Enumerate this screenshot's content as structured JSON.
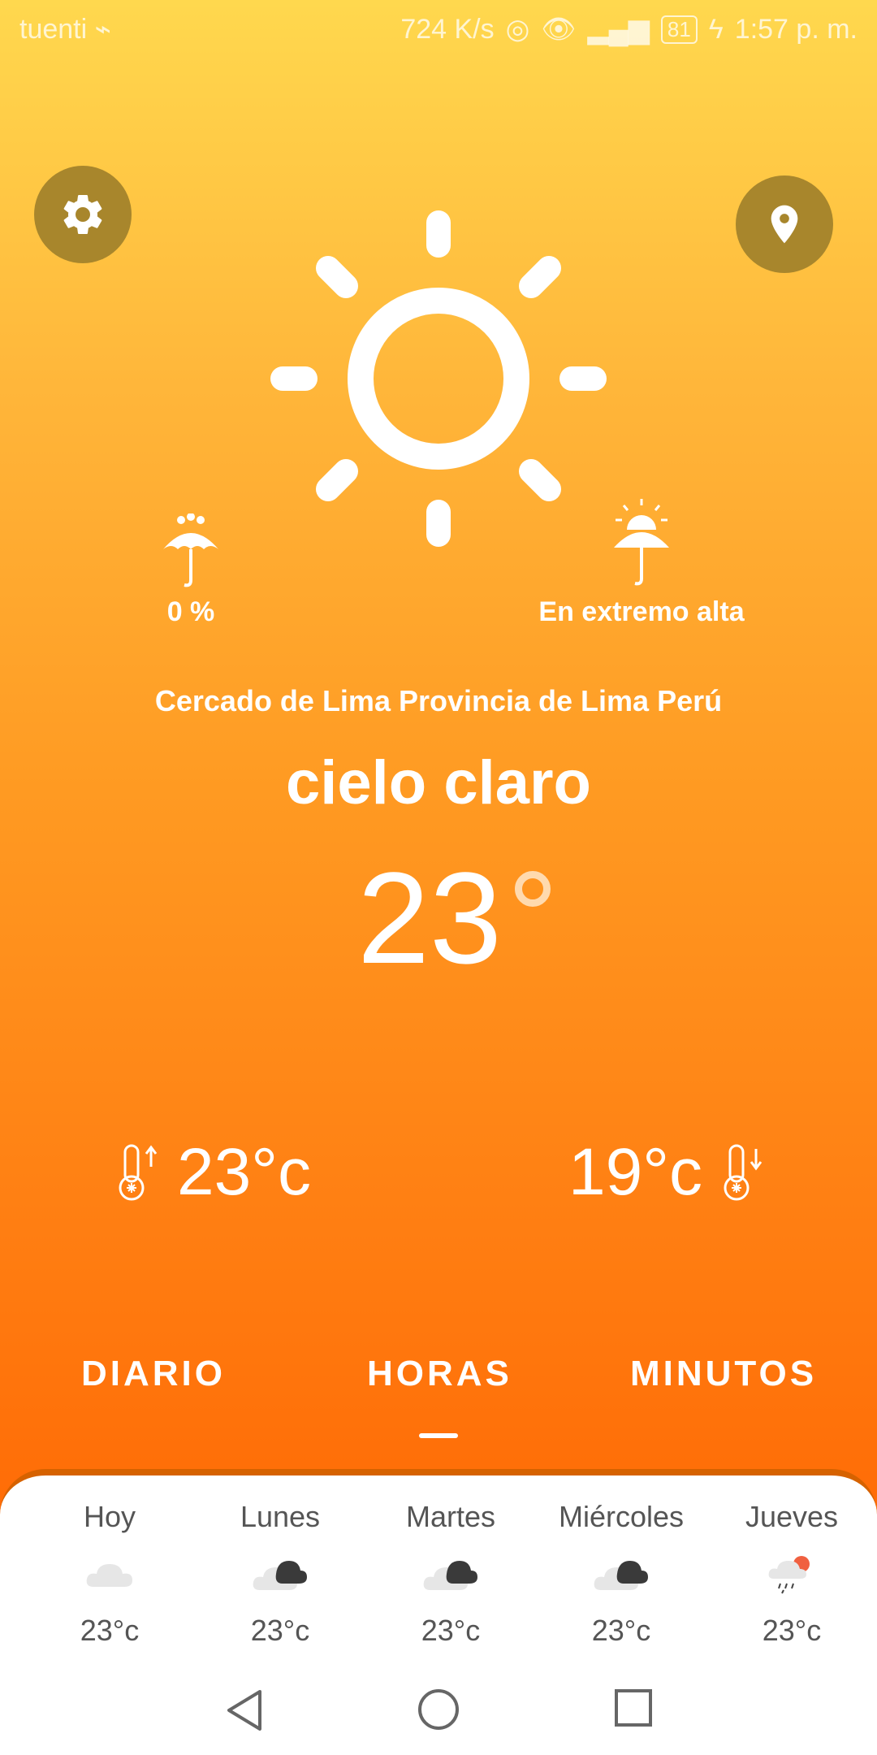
{
  "status_bar": {
    "carrier": "tuenti",
    "speed": "724 K/s",
    "battery": "81",
    "time": "1:57 p. m."
  },
  "weather": {
    "rain_probability": "0 %",
    "uv_index": "En extremo alta",
    "location": "Cercado de Lima  Provincia de Lima Perú",
    "condition": "cielo claro",
    "current_temp": "23",
    "max_temp": "23°c",
    "min_temp": "19°c"
  },
  "tabs": [
    {
      "label": "DIARIO"
    },
    {
      "label": "HORAS",
      "selected": true
    },
    {
      "label": "MINUTOS"
    }
  ],
  "forecast": [
    {
      "day": "Hoy",
      "temp": "23°c",
      "icon": "cloud-icon"
    },
    {
      "day": "Lunes",
      "temp": "23°c",
      "icon": "cloudy-night-icon"
    },
    {
      "day": "Martes",
      "temp": "23°c",
      "icon": "cloudy-night-icon"
    },
    {
      "day": "Miércoles",
      "temp": "23°c",
      "icon": "cloudy-night-icon"
    },
    {
      "day": "Jueves",
      "temp": "23°c",
      "icon": "rain-sun-icon"
    }
  ],
  "icons": {
    "settings": "gear-icon",
    "location": "location-pin-icon",
    "main": "sun-icon",
    "rain": "umbrella-rain-icon",
    "uv": "uv-umbrella-icon",
    "max": "thermometer-up-icon",
    "min": "thermometer-down-icon"
  },
  "colors": {
    "gradient_top": "#FFD84E",
    "gradient_bottom": "#F96200",
    "circle_button": "#A8862C",
    "panel_border": "#D66200"
  }
}
